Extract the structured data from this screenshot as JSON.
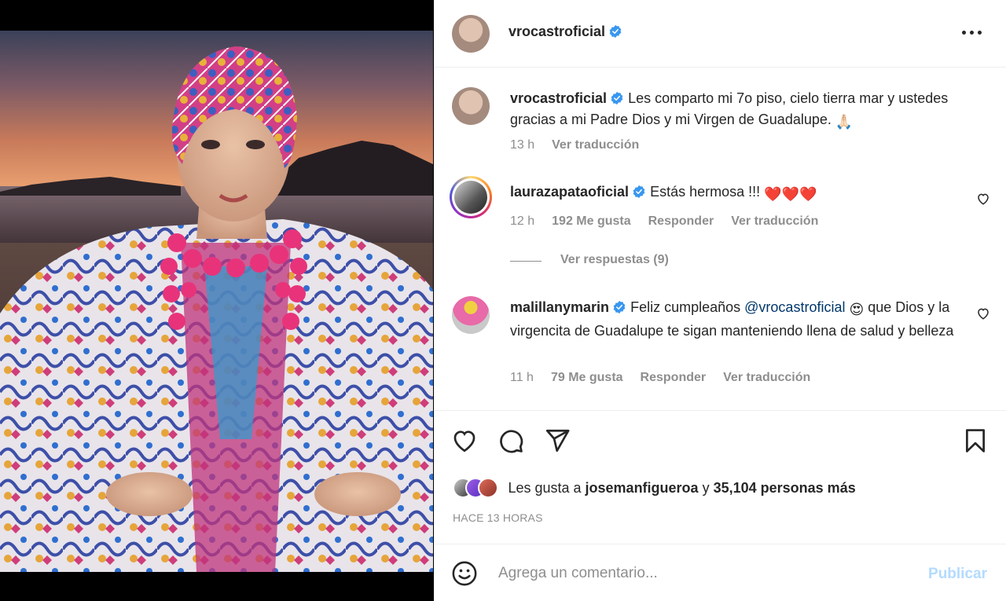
{
  "post": {
    "author": "vrocastroficial",
    "more_icon": "more-horizontal-icon"
  },
  "caption": {
    "user": "vrocastroficial",
    "text": "Les comparto mi 7o piso, cielo tierra mar y ustedes gracias a mi Padre Dios y mi Virgen de Guadalupe. ",
    "emoji": "🙏🏻",
    "time": "13 h",
    "translate": "Ver traducción"
  },
  "comments": [
    {
      "user": "laurazapataoficial",
      "text": "Estás hermosa !!! ",
      "emoji": "❤️❤️❤️",
      "time": "12 h",
      "likes": "192 Me gusta",
      "reply": "Responder",
      "translate": "Ver traducción",
      "view_replies": "Ver respuestas (9)"
    },
    {
      "user": "malillanymarin",
      "text_before": "Feliz cumpleaños ",
      "mention": "@vrocastroficial",
      "emoji": "😍",
      "text_after": " que Dios y la virgencita de Guadalupe te sigan manteniendo llena de salud y belleza",
      "time": "11 h",
      "likes": "79 Me gusta",
      "reply": "Responder",
      "translate": "Ver traducción"
    }
  ],
  "likes": {
    "prefix": "Les gusta a ",
    "user": "josemanfigueroa",
    "middle": " y ",
    "count": "35,104 personas más"
  },
  "timestamp": "HACE 13 HORAS",
  "add_comment": {
    "placeholder": "Agrega un comentario...",
    "publish": "Publicar"
  },
  "colors": {
    "verified": "#3897f0",
    "link": "#00376b",
    "publish_disabled": "#b3dbff",
    "heart": "#e0245e"
  }
}
